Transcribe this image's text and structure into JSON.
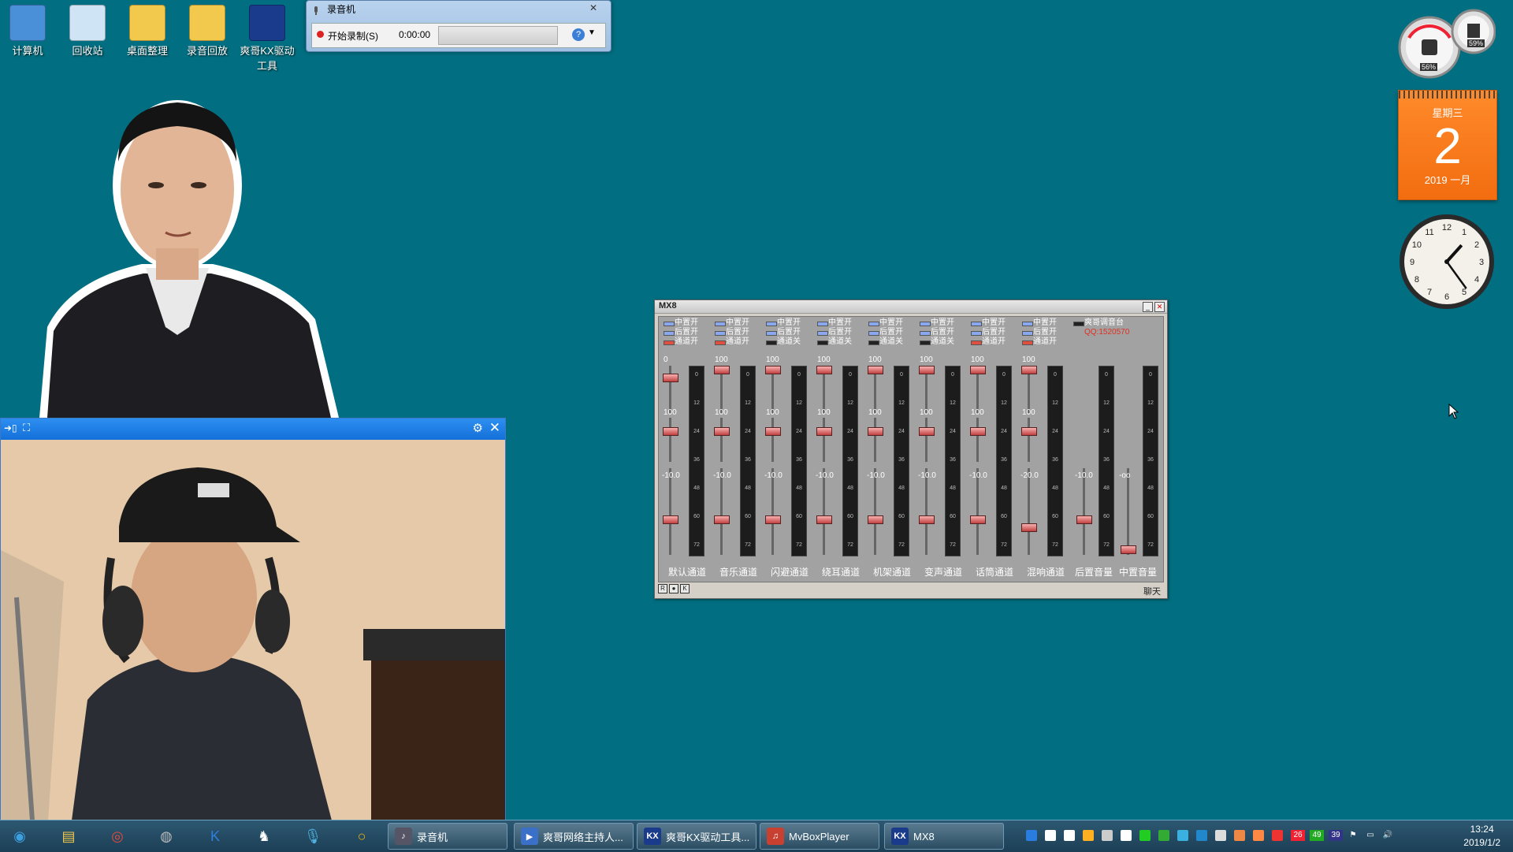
{
  "desktop_icons": [
    {
      "label": "计算机",
      "icon": "computer-icon"
    },
    {
      "label": "回收站",
      "icon": "recycle-bin-icon"
    },
    {
      "label": "桌面整理",
      "icon": "folder-icon"
    },
    {
      "label": "录音回放",
      "icon": "folder-icon"
    },
    {
      "label": "爽哥KX驱动工具",
      "icon": "kx-driver-icon"
    }
  ],
  "recorder": {
    "title": "录音机",
    "record_label": "开始录制(S)",
    "time": "0:00:00",
    "help": "?"
  },
  "webcam": {
    "title": ""
  },
  "calendar": {
    "weekday": "星期三",
    "day": "2",
    "month_year": "2019 一月"
  },
  "clock": {
    "hour": 13,
    "minute": 24
  },
  "meter_gadget": {
    "cpu": "56%",
    "mem": "59%"
  },
  "mixer": {
    "title": "MX8",
    "channels": [
      {
        "label": "默认通道",
        "opts": [
          "中置开",
          "后置开",
          "通道开"
        ],
        "top_value": "0",
        "mid_value": "100",
        "bottom_value": "-10.0",
        "fader1": 0.8,
        "fader2": 0.75,
        "fader3": 0.4
      },
      {
        "label": "音乐通道",
        "opts": [
          "中置开",
          "后置开",
          "通道开"
        ],
        "top_value": "100",
        "mid_value": "100",
        "bottom_value": "-10.0",
        "fader1": 1.0,
        "fader2": 0.75,
        "fader3": 0.4
      },
      {
        "label": "闪避通道",
        "opts": [
          "中置开",
          "后置开",
          "通道关"
        ],
        "top_value": "100",
        "mid_value": "100",
        "bottom_value": "-10.0",
        "fader1": 1.0,
        "fader2": 0.75,
        "fader3": 0.4
      },
      {
        "label": "绕耳通道",
        "opts": [
          "中置开",
          "后置开",
          "通道关"
        ],
        "top_value": "100",
        "mid_value": "100",
        "bottom_value": "-10.0",
        "fader1": 1.0,
        "fader2": 0.75,
        "fader3": 0.4
      },
      {
        "label": "机架通道",
        "opts": [
          "中置开",
          "后置开",
          "通道关"
        ],
        "top_value": "100",
        "mid_value": "100",
        "bottom_value": "-10.0",
        "fader1": 1.0,
        "fader2": 0.75,
        "fader3": 0.4
      },
      {
        "label": "变声通道",
        "opts": [
          "中置开",
          "后置开",
          "通道关"
        ],
        "top_value": "100",
        "mid_value": "100",
        "bottom_value": "-10.0",
        "fader1": 1.0,
        "fader2": 0.75,
        "fader3": 0.4
      },
      {
        "label": "话筒通道",
        "opts": [
          "中置开",
          "后置开",
          "通道开"
        ],
        "top_value": "100",
        "mid_value": "100",
        "bottom_value": "-10.0",
        "fader1": 1.0,
        "fader2": 0.75,
        "fader3": 0.4
      },
      {
        "label": "混响通道",
        "opts": [
          "中置开",
          "后置开",
          "通道开"
        ],
        "top_value": "100",
        "mid_value": "100",
        "bottom_value": "-20.0",
        "fader1": 1.0,
        "fader2": 0.75,
        "fader3": 0.3
      }
    ],
    "master": [
      {
        "label": "后置音量",
        "value": "-10.0",
        "fader": 0.4
      },
      {
        "label": "中置音量",
        "value": "-oo",
        "fader": 0.02
      }
    ],
    "extra_opt": "爽哥调音台",
    "extra_red": "QQ:1520570",
    "vu_scale": [
      "0",
      "12",
      "24",
      "36",
      "48",
      "60",
      "72"
    ],
    "status_boxes": [
      "R",
      "●",
      "K"
    ],
    "status_right": "聊天"
  },
  "taskbar": {
    "pins": [
      "start-orb-icon",
      "explorer-icon",
      "chrome-icon",
      "media-icon",
      "kugou-icon",
      "fox-icon",
      "mic-app-icon",
      "circle-app-icon"
    ],
    "tasks": [
      {
        "label": "录音机",
        "icon": "mic-icon"
      },
      {
        "label": "爽哥网络主持人...",
        "icon": "play-icon"
      },
      {
        "label": "爽哥KX驱动工具...",
        "icon": "kx-icon"
      },
      {
        "label": "MvBoxPlayer",
        "icon": "mvbox-icon"
      },
      {
        "label": "MX8",
        "icon": "kx-icon"
      }
    ],
    "time": "13:24",
    "date": "2019/1/2",
    "tray_numbers": [
      "26",
      "49",
      "39"
    ]
  }
}
